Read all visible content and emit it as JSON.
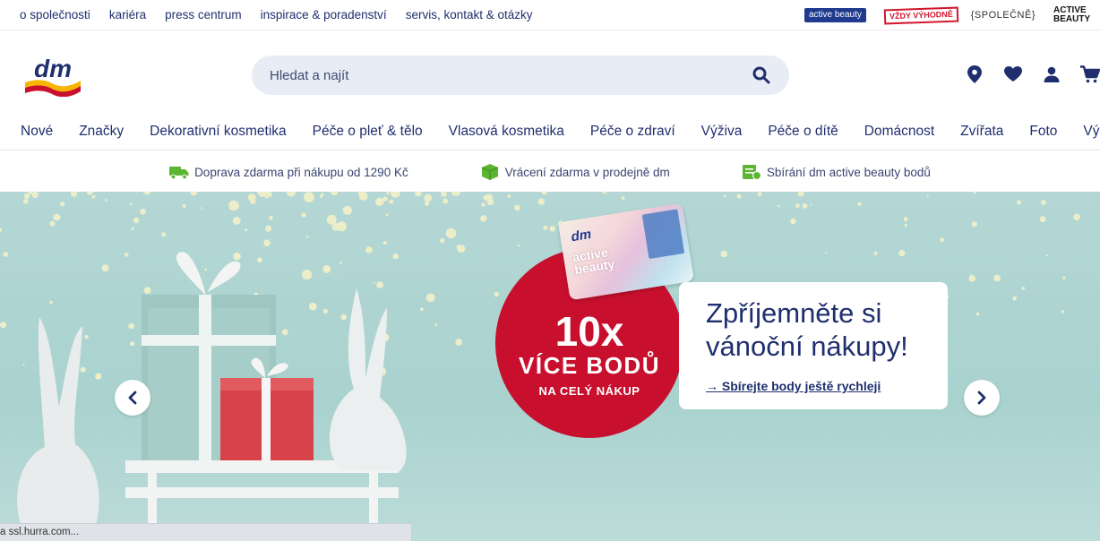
{
  "topbar": {
    "links": [
      "o společnosti",
      "kariéra",
      "press centrum",
      "inspirace & poradenství",
      "servis, kontakt & otázky"
    ],
    "brands": {
      "active_beauty": "active beauty",
      "vzdy_vyhodne": "VŽDY VÝHODNĚ",
      "spolecne": "{SPOLEČNĚ}",
      "active_beauty_logo": "ACTIVE BEAUTY"
    }
  },
  "header": {
    "logo_text": "dm",
    "search": {
      "placeholder": "Hledat a najít"
    },
    "icons": [
      "map-pin-icon",
      "heart-icon",
      "user-icon",
      "cart-icon"
    ]
  },
  "nav": {
    "items": [
      "Nové",
      "Značky",
      "Dekorativní kosmetika",
      "Péče o pleť & tělo",
      "Vlasová kosmetika",
      "Péče o zdraví",
      "Výživa",
      "Péče o dítě",
      "Domácnost",
      "Zvířata",
      "Foto",
      "Výprodej"
    ]
  },
  "benefits": [
    {
      "icon": "truck-icon",
      "text": "Doprava zdarma při nákupu od 1290 Kč"
    },
    {
      "icon": "box-icon",
      "text": "Vrácení zdarma v prodejně dm"
    },
    {
      "icon": "card-icon",
      "text": "Sbírání dm active beauty bodů"
    }
  ],
  "hero": {
    "card": {
      "brand": "dm",
      "line1": "active",
      "line2": "beauty"
    },
    "circle": {
      "big": "10x",
      "line2": "VÍCE BODŮ",
      "line3": "NA CELÝ NÁKUP"
    },
    "message": {
      "title": "Zpříjemněte si vánoční nákupy!",
      "link": "→ Sbírejte body ještě rychleji"
    }
  },
  "status": {
    "text": "a ssl.hurra.com..."
  },
  "colors": {
    "brand_blue": "#1f2f6e",
    "brand_red": "#c8102e",
    "brand_yellow": "#f7b500",
    "hero_bg": "#b4d7d5"
  }
}
